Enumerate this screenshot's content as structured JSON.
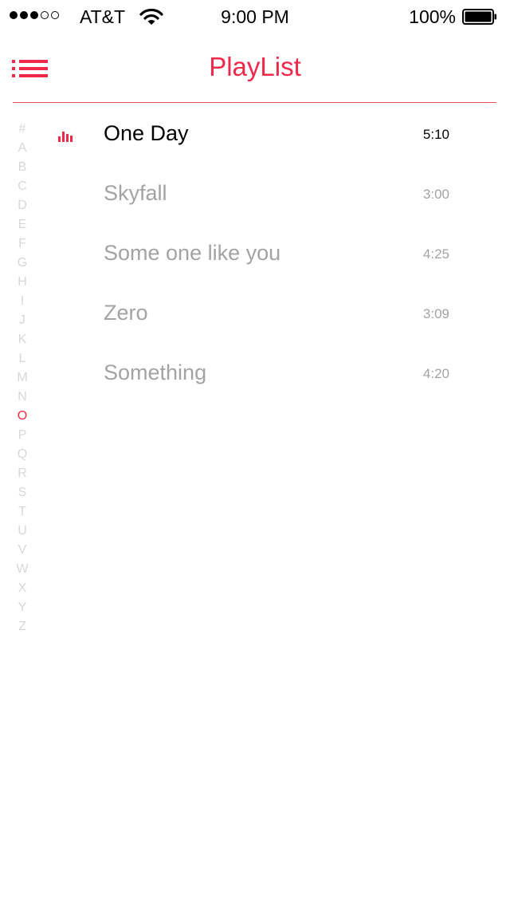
{
  "status_bar": {
    "signal_bars_filled": 3,
    "signal_bars_total": 5,
    "carrier": "AT&T",
    "wifi_icon": "wifi-icon",
    "time": "9:00 PM",
    "battery_percent": "100%",
    "battery_level": 1.0
  },
  "header": {
    "menu_icon": "list-menu-icon",
    "title": "PlayList"
  },
  "alpha_index": {
    "letters": [
      "#",
      "A",
      "B",
      "C",
      "D",
      "E",
      "F",
      "G",
      "H",
      "I",
      "J",
      "K",
      "L",
      "M",
      "N",
      "O",
      "P",
      "Q",
      "R",
      "S",
      "T",
      "U",
      "V",
      "W",
      "X",
      "Y",
      "Z"
    ],
    "active": "O"
  },
  "songs": [
    {
      "title": "One Day",
      "duration": "5:10",
      "playing": true
    },
    {
      "title": "Skyfall",
      "duration": "3:00",
      "playing": false
    },
    {
      "title": "Some one like you",
      "duration": "4:25",
      "playing": false
    },
    {
      "title": "Zero",
      "duration": "3:09",
      "playing": false
    },
    {
      "title": "Something",
      "duration": "4:20",
      "playing": false
    }
  ],
  "colors": {
    "accent": "#f0284a",
    "inactive_text": "#a3a3a3",
    "index_text": "#d7d7d7"
  }
}
